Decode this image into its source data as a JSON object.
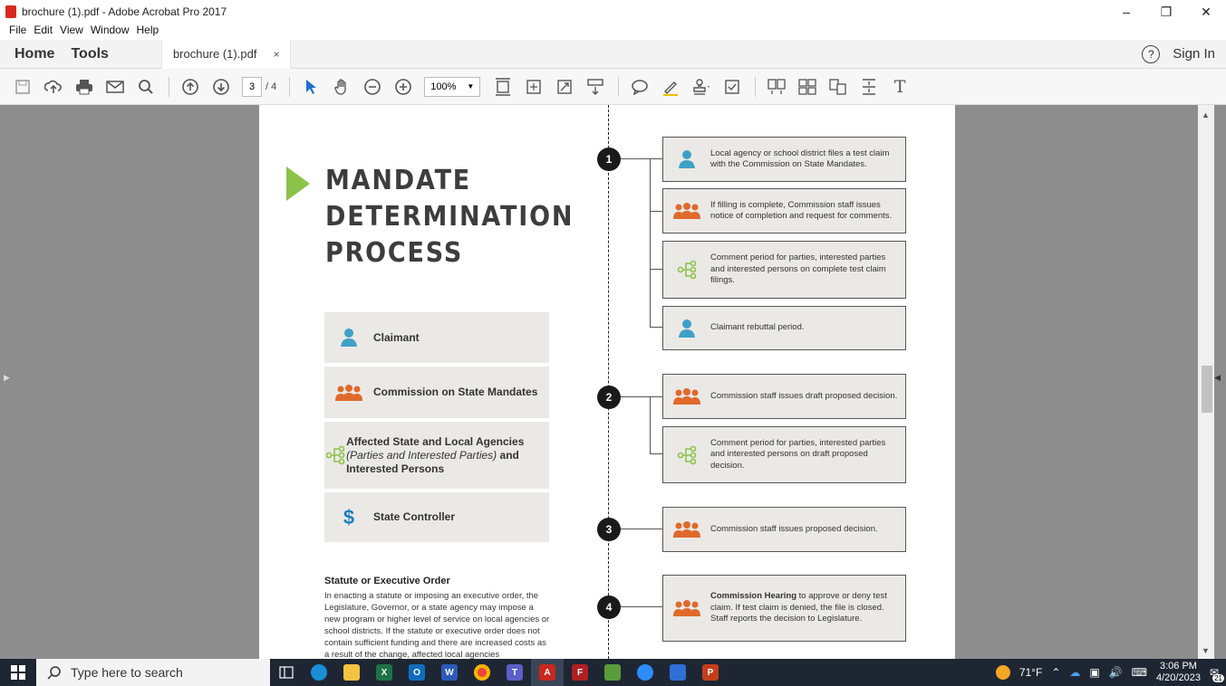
{
  "window": {
    "title": "brochure (1).pdf - Adobe Acrobat Pro 2017"
  },
  "menu": [
    "File",
    "Edit",
    "View",
    "Window",
    "Help"
  ],
  "nav": {
    "home": "Home",
    "tools": "Tools"
  },
  "tab": {
    "label": "brochure (1).pdf",
    "close": "×"
  },
  "topright": {
    "help": "?",
    "signin": "Sign In"
  },
  "toolbar": {
    "page_current": "3",
    "page_total": "/ 4",
    "zoom": "100%"
  },
  "brochure": {
    "title_lines": [
      "MANDATE",
      "DETERMINATION",
      "PROCESS"
    ],
    "legend": [
      {
        "icon": "person-icon",
        "label": "Claimant"
      },
      {
        "icon": "group-icon",
        "label": "Commission on State Mandates"
      },
      {
        "icon": "branch-icon",
        "label_bold": "Affected State and Local Agencies",
        "label_italic": "(Parties and Interested Parties)",
        "label_bold2": "and Interested Persons"
      },
      {
        "icon": "dollar-icon",
        "label": "State Controller"
      }
    ],
    "statute": {
      "heading": "Statute or Executive Order",
      "body": "In enacting a statute or imposing an executive order, the Legislature, Governor, or a state agency may impose a new program or higher level of service on local agencies or school districts. If the statute or executive order does not contain sufficient funding and there are increased costs as a result of the change, affected local agencies"
    },
    "steps": [
      "1",
      "2",
      "3",
      "4"
    ],
    "boxes": [
      {
        "icon": "person-icon",
        "text": "Local agency or school district files a test claim with the Commission on State Mandates."
      },
      {
        "icon": "group-icon",
        "text": "If filling is complete, Commission staff issues notice of completion and request for comments."
      },
      {
        "icon": "branch-icon",
        "text": "Comment period for parties, interested parties and interested persons on complete test claim filings."
      },
      {
        "icon": "person-icon",
        "text": "Claimant rebuttal period."
      },
      {
        "icon": "group-icon",
        "text": "Commission staff issues draft proposed decision."
      },
      {
        "icon": "branch-icon",
        "text": "Comment period for parties, interested parties and interested persons on draft proposed decision."
      },
      {
        "icon": "group-icon",
        "text": "Commission staff issues proposed decision."
      },
      {
        "icon": "group-icon",
        "bold": "Commission Hearing",
        "text": " to approve or deny test claim. If test claim is denied, the file is closed. Staff reports the decision to Legislature."
      }
    ]
  },
  "colors": {
    "claimant": "#3fa0c8",
    "commission": "#e06a2b",
    "agencies": "#8bc34a",
    "controller": "#1e7fc0",
    "taskbar": "#1f2633"
  },
  "taskbar": {
    "search_placeholder": "Type here to search",
    "weather": "71°F",
    "time": "3:06 PM",
    "date": "4/20/2023",
    "notifications": "21"
  }
}
